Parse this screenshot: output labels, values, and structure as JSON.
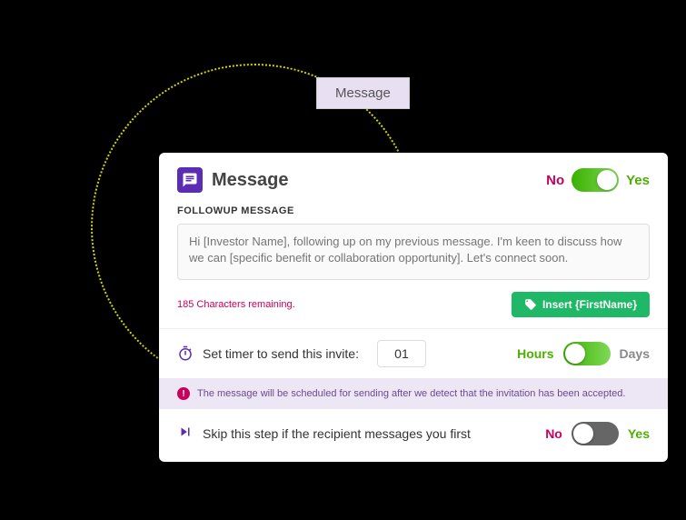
{
  "tab": {
    "label": "Message"
  },
  "header": {
    "title": "Message",
    "toggle_no": "No",
    "toggle_yes": "Yes"
  },
  "followup": {
    "section_label": "FOLLOWUP MESSAGE",
    "placeholder": "Hi [Investor Name], following up on my previous message. I'm keen to discuss how we can [specific benefit or collaboration opportunity]. Let's connect soon.",
    "chars_remaining": "185 Characters remaining.",
    "insert_btn": "Insert {FirstName}"
  },
  "timer": {
    "label": "Set timer to send this invite:",
    "value": "01",
    "hours": "Hours",
    "days": "Days"
  },
  "info": {
    "text": "The message will be scheduled for sending after we detect that the invitation has been accepted."
  },
  "skip": {
    "label": "Skip this step if the recipient messages you first",
    "no": "No",
    "yes": "Yes"
  }
}
